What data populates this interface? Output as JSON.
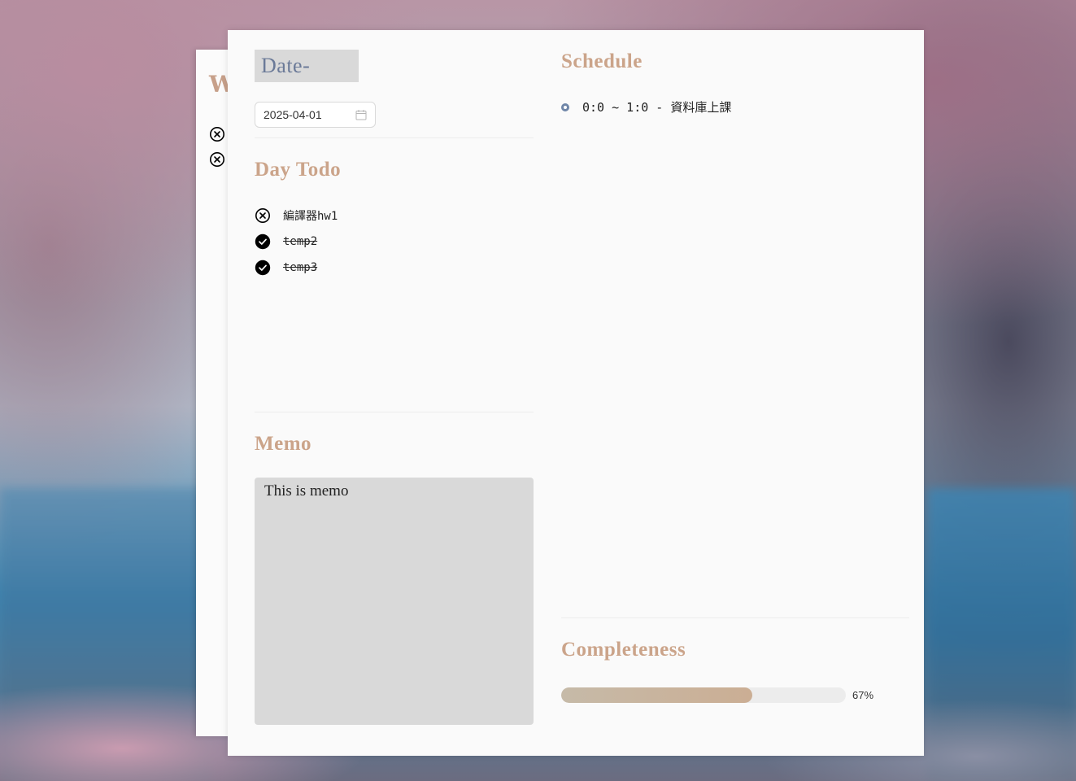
{
  "back_page": {
    "title": "W"
  },
  "date": {
    "title": "Date-",
    "picker_value": "2025-04-01"
  },
  "day_todo": {
    "title": "Day Todo",
    "items": [
      {
        "text": "編譯器hw1",
        "done": false
      },
      {
        "text": "temp2",
        "done": true
      },
      {
        "text": "temp3",
        "done": true
      }
    ]
  },
  "memo": {
    "title": "Memo",
    "text": "This is memo"
  },
  "schedule": {
    "title": "Schedule",
    "items": [
      {
        "text": "0:0 ~ 1:0 - 資料庫上課"
      }
    ]
  },
  "completeness": {
    "title": "Completeness",
    "percent": 67,
    "label": "67%"
  },
  "colors": {
    "title_accent": "#cba48a",
    "date_title": "#6b7a98",
    "schedule_dot": "#6f86a8"
  }
}
